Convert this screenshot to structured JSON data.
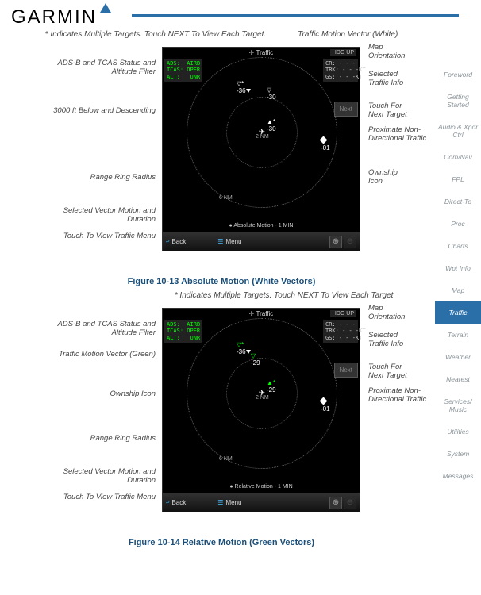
{
  "brand": "GARMIN",
  "nav": [
    "Foreword",
    "Getting Started",
    "Audio & Xpdr Ctrl",
    "Com/Nav",
    "FPL",
    "Direct-To",
    "Proc",
    "Charts",
    "Wpt Info",
    "Map",
    "Traffic",
    "Terrain",
    "Weather",
    "Nearest",
    "Services/ Music",
    "Utilities",
    "System",
    "Messages"
  ],
  "nav_active": "Traffic",
  "fig1": {
    "caption": "Figure 10-13  Absolute Motion (White Vectors)",
    "top_note": "* Indicates Multiple Targets. Touch NEXT To View Each Target.",
    "top_right_label": "Traffic Motion Vector (White)",
    "labels_left": {
      "adsb": "ADS-B and TCAS Status and Altitude Filter",
      "below": "3000 ft Below and Descending",
      "range": "Range Ring Radius",
      "vector": "Selected Vector Motion and Duration",
      "menu": "Touch To View Traffic Menu"
    },
    "labels_right": {
      "orient": "Map Orientation",
      "selinfo": "Selected Traffic Info",
      "next": "Touch For Next Target",
      "prox": "Proximate Non-Directional Traffic",
      "ownship": "Ownship Icon"
    },
    "screen": {
      "title": "Traffic",
      "hdg": "HDG UP",
      "filter": "ADS:  AIRB\nTCAS: OPER\nALT:   UNR",
      "info": "CR: - - -\nTRK: - - -KT\nGS: - - -KT",
      "next_btn": "Next",
      "motion": "Absolute Motion - 1 MIN",
      "range_inner": "2 NM",
      "range_outer": "6 NM",
      "btn_back": "Back",
      "btn_menu": "Menu",
      "zoom_in": "In",
      "zoom_out": "Out",
      "targets": {
        "t1": "-36",
        "t2": "-30",
        "t3": "-30",
        "t4": "-01"
      }
    }
  },
  "fig2": {
    "caption": "Figure 10-14  Relative Motion (Green Vectors)",
    "top_note": "* Indicates Multiple Targets. Touch NEXT To View Each Target.",
    "labels_left": {
      "adsb": "ADS-B and TCAS Status and Altitude Filter",
      "vec_green": "Traffic Motion Vector (Green)",
      "ownship": "Ownship Icon",
      "range": "Range Ring Radius",
      "vector": "Selected Vector Motion and Duration",
      "menu": "Touch To View Traffic Menu"
    },
    "labels_right": {
      "orient": "Map Orientation",
      "selinfo": "Selected Traffic Info",
      "next": "Touch For Next Target",
      "prox": "Proximate Non-Directional Traffic"
    },
    "screen": {
      "title": "Traffic",
      "hdg": "HDG UP",
      "filter": "ADS:  AIRB\nTCAS: OPER\nALT:   UNR",
      "info": "CR: - - -\nTRK: - - -KT\nGS: - - -KT",
      "next_btn": "Next",
      "motion": "Relative Motion - 1 MIN",
      "range_inner": "2 NM",
      "range_outer": "6 NM",
      "btn_back": "Back",
      "btn_menu": "Menu",
      "zoom_in": "In",
      "zoom_out": "Out",
      "targets": {
        "t1": "-36",
        "t2": "-29",
        "t3": "-29",
        "t4": "-01"
      }
    }
  }
}
